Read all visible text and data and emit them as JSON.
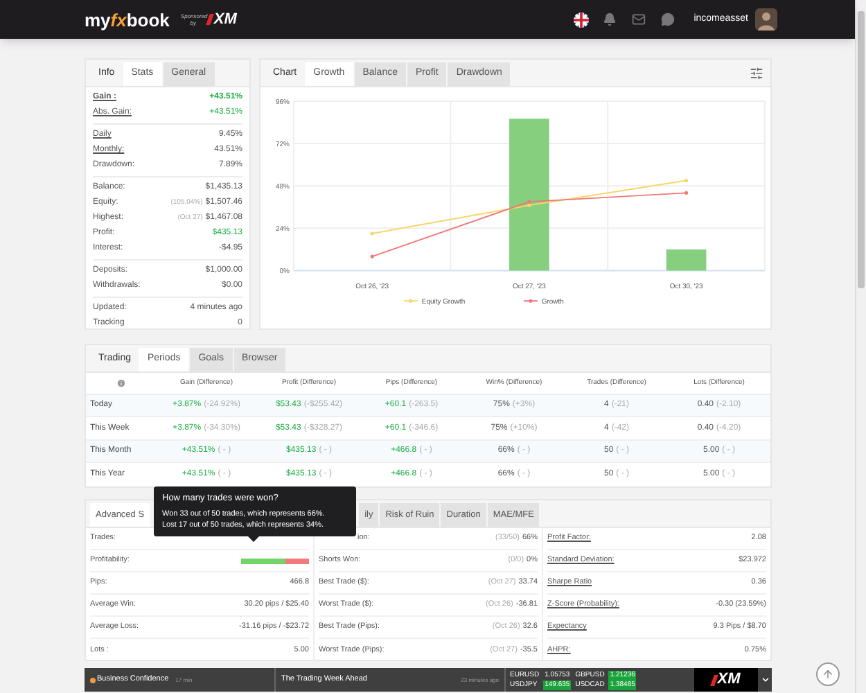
{
  "header": {
    "logo": {
      "part_1": "my",
      "part_2": "fx",
      "part_3": "book"
    },
    "sponsor_label": "Sponsored by",
    "sponsor_logo": "XM",
    "username": "incomeasset"
  },
  "info_panel": {
    "title": "Info",
    "tabs": [
      {
        "label": "Stats",
        "selected": true
      },
      {
        "label": "General",
        "selected": false
      }
    ],
    "groups": [
      [
        {
          "label": "Gain :",
          "value": "+43.51%",
          "underlined": true,
          "positive": true,
          "bold": true
        },
        {
          "label": "Abs. Gain:",
          "value": "+43.51%",
          "underlined": true,
          "positive": true,
          "bold": false
        }
      ],
      [
        {
          "label": "Daily",
          "value": "9.45%",
          "underlined": true,
          "positive": false,
          "bold": false
        },
        {
          "label": "Monthly:",
          "value": "43.51%",
          "underlined": true,
          "positive": false,
          "bold": false
        },
        {
          "label": "Drawdown:",
          "value": "7.89%",
          "underlined": false,
          "positive": false,
          "bold": false
        }
      ],
      [
        {
          "label": "Balance:",
          "value": "$1,435.13",
          "underlined": false,
          "positive": false,
          "bold": false
        },
        {
          "label": "Equity:",
          "note": "(105.04%)",
          "value": "$1,507.46",
          "underlined": false,
          "positive": false,
          "bold": false
        },
        {
          "label": "Highest:",
          "note": "(Oct 27)",
          "value": "$1,467.08",
          "underlined": false,
          "positive": false,
          "bold": false
        },
        {
          "label": "Profit:",
          "value": "$435.13",
          "underlined": false,
          "positive": true,
          "bold": false
        },
        {
          "label": "Interest:",
          "value": "-$4.95",
          "underlined": false,
          "positive": false,
          "bold": false
        }
      ],
      [
        {
          "label": "Deposits:",
          "value": "$1,000.00",
          "underlined": false,
          "positive": false,
          "bold": false
        },
        {
          "label": "Withdrawals:",
          "value": "$0.00",
          "underlined": false,
          "positive": false,
          "bold": false
        }
      ],
      [
        {
          "label": "Updated:",
          "value": "4 minutes ago",
          "underlined": false,
          "positive": false,
          "bold": false
        },
        {
          "label": "Tracking",
          "value": "0",
          "underlined": false,
          "positive": false,
          "bold": false
        }
      ]
    ]
  },
  "chart_panel": {
    "title": "Chart",
    "tabs": [
      {
        "label": "Growth",
        "selected": true
      },
      {
        "label": "Balance",
        "selected": false
      },
      {
        "label": "Profit",
        "selected": false
      },
      {
        "label": "Drawdown",
        "selected": false
      }
    ],
    "chart_data": {
      "type": "bar",
      "grid": true,
      "legend": true,
      "categories": [
        "Oct 26, '23",
        "Oct 27, '23",
        "Oct 30, '23"
      ],
      "ylim": [
        0,
        96
      ],
      "yticks": [
        {
          "value": 0,
          "label": "0%"
        },
        {
          "value": 24,
          "label": "24%"
        },
        {
          "value": 48,
          "label": "48%"
        },
        {
          "value": 72,
          "label": "72%"
        },
        {
          "value": 96,
          "label": "96%"
        }
      ],
      "series": [
        {
          "color": "#86cf7e",
          "values": [
            0,
            86,
            12
          ]
        },
        {
          "name": "Equity Growth",
          "type": "line",
          "color": "#f8d66a",
          "values": [
            21,
            37,
            51
          ]
        },
        {
          "name": "Growth",
          "type": "line",
          "color": "#f07878",
          "values": [
            8,
            39,
            44
          ]
        }
      ]
    }
  },
  "periods_panel": {
    "title": "Trading",
    "tabs": [
      {
        "label": "Periods",
        "selected": true
      },
      {
        "label": "Goals",
        "selected": false
      },
      {
        "label": "Browser",
        "selected": false
      }
    ],
    "columns": [
      "Gain (Difference)",
      "Profit (Difference)",
      "Pips (Difference)",
      "Win% (Difference)",
      "Trades (Difference)",
      "Lots (Difference)"
    ],
    "rows": [
      {
        "label": "Today",
        "cells": [
          {
            "value": "+3.87%",
            "diff": "(-24.92%)",
            "positive": true
          },
          {
            "value": "$53.43",
            "diff": "(-$255.42)",
            "positive": true
          },
          {
            "value": "+60.1",
            "diff": "(-263.5)",
            "positive": true
          },
          {
            "value": "75%",
            "diff": "(+3%)",
            "positive": false
          },
          {
            "value": "4",
            "diff": "(-21)",
            "positive": false
          },
          {
            "value": "0.40",
            "diff": "(-2.10)",
            "positive": false
          }
        ]
      },
      {
        "label": "This Week",
        "cells": [
          {
            "value": "+3.87%",
            "diff": "(-34.30%)",
            "positive": true
          },
          {
            "value": "$53.43",
            "diff": "(-$328.27)",
            "positive": true
          },
          {
            "value": "+60.1",
            "diff": "(-346.6)",
            "positive": true
          },
          {
            "value": "75%",
            "diff": "(+10%)",
            "positive": false
          },
          {
            "value": "4",
            "diff": "(-42)",
            "positive": false
          },
          {
            "value": "0.40",
            "diff": "(-4.20)",
            "positive": false
          }
        ]
      },
      {
        "label": "This Month",
        "cells": [
          {
            "value": "+43.51%",
            "diff": "( - )",
            "positive": true
          },
          {
            "value": "$435.13",
            "diff": "( - )",
            "positive": true
          },
          {
            "value": "+466.8",
            "diff": "( - )",
            "positive": true
          },
          {
            "value": "66%",
            "diff": "( - )",
            "positive": false
          },
          {
            "value": "50",
            "diff": "( - )",
            "positive": false
          },
          {
            "value": "5.00",
            "diff": "( - )",
            "positive": false
          }
        ]
      },
      {
        "label": "This Year",
        "cells": [
          {
            "value": "+43.51%",
            "diff": "( - )",
            "positive": true
          },
          {
            "value": "$435.13",
            "diff": "( - )",
            "positive": true
          },
          {
            "value": "+466.8",
            "diff": "( - )",
            "positive": true
          },
          {
            "value": "66%",
            "diff": "( - )",
            "positive": false
          },
          {
            "value": "50",
            "diff": "( - )",
            "positive": false
          },
          {
            "value": "5.00",
            "diff": "( - )",
            "positive": false
          }
        ]
      }
    ]
  },
  "advanced_panel": {
    "tabs": [
      {
        "label": "Advanced S",
        "selected": true
      },
      {
        "label": "ily",
        "selected": false
      },
      {
        "label": "Risk of Ruin",
        "selected": false
      },
      {
        "label": "Duration",
        "selected": false
      },
      {
        "label": "MAE/MFE",
        "selected": false
      }
    ],
    "columns": [
      [
        {
          "label": "Trades:",
          "kind": "text"
        },
        {
          "label": "Profitability:",
          "kind": "bar",
          "level": 0.66
        },
        {
          "label": "Pips:",
          "value": "466.8",
          "kind": "text"
        },
        {
          "label": "Average Win:",
          "value": "30.20 pips / $25.40",
          "kind": "text"
        },
        {
          "label": "Average Loss:",
          "value": "-31.16 pips / -$23.72",
          "kind": "text"
        },
        {
          "label": "Lots :",
          "value": "5.00",
          "kind": "text"
        }
      ],
      [
        {
          "label": "ion:",
          "note": "(33/50)",
          "value": "66%",
          "kind": "covered"
        },
        {
          "label": "Shorts Won:",
          "note": "(0/0)",
          "value": "0%",
          "kind": "text"
        },
        {
          "label": "Best Trade ($):",
          "note": "(Oct 27)",
          "value": "33.74",
          "kind": "text"
        },
        {
          "label": "Worst Trade ($):",
          "note": "(Oct 26)",
          "value": "-36.81",
          "kind": "text"
        },
        {
          "label": "Best Trade (Pips):",
          "note": "(Oct 26)",
          "value": "32.6",
          "kind": "text"
        },
        {
          "label": "Worst Trade (Pips):",
          "note": "(Oct 27)",
          "value": "-35.5",
          "kind": "text"
        }
      ],
      [
        {
          "label": "Profit Factor:",
          "value": "2.08",
          "kind": "link"
        },
        {
          "label": "Standard Deviation:",
          "value": "$23.972",
          "kind": "link"
        },
        {
          "label": "Sharpe Ratio",
          "value": "0.36",
          "kind": "link"
        },
        {
          "label": "Z-Score (Probability):",
          "value": "-0.30 (23.59%)",
          "kind": "link"
        },
        {
          "label": "Expectancy",
          "value": "9.3 Pips / $8.70",
          "kind": "link"
        },
        {
          "label": "AHPR:",
          "value": "0.75%",
          "kind": "link"
        }
      ]
    ],
    "tooltip": {
      "title": "How many trades were won?",
      "lines": [
        "Won 33 out of 50 trades, which represents 66%.",
        "Lost 17 out of 50 trades, which represents 34%."
      ]
    }
  },
  "ticker": {
    "news": [
      {
        "title": "Business Confidence",
        "time": "17 min",
        "color": "#f59a3c"
      },
      {
        "title": "The Trading Week Ahead",
        "time": "23 minutes ago"
      }
    ],
    "quotes": [
      {
        "symbol": "EURUSD",
        "price": "1.05753",
        "highlighted": false
      },
      {
        "symbol": "GBPUSD",
        "price": "1.21236",
        "highlighted": true
      },
      {
        "symbol": "USDJPY",
        "price": "149.635",
        "highlighted": true
      },
      {
        "symbol": "USDCAD",
        "price": "1.38485",
        "highlighted": true
      }
    ],
    "logo": "XM"
  }
}
